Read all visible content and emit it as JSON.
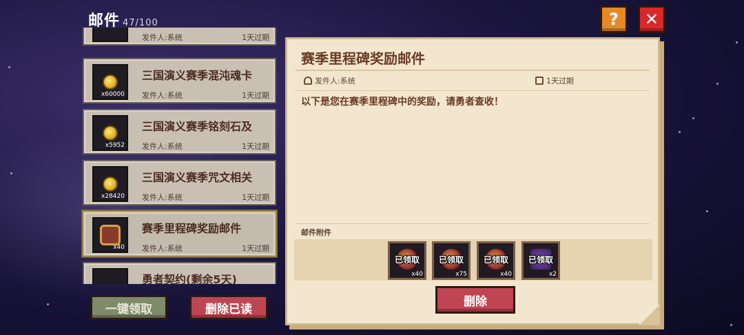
{
  "header": {
    "title": "邮件",
    "count": "47/100",
    "help": "?",
    "close": "✕"
  },
  "mail_list": [
    {
      "title": "",
      "sender": "发件人:系统",
      "expire": "1天过期",
      "qty": "",
      "icon": "item-icon"
    },
    {
      "title": "三国演义赛季混沌魂卡",
      "sender": "发件人:系统",
      "expire": "1天过期",
      "qty": "x60000",
      "icon": "gold-coin-icon"
    },
    {
      "title": "三国演义赛季铭刻石及",
      "sender": "发件人:系统",
      "expire": "1天过期",
      "qty": "x5952",
      "icon": "gold-coin-icon"
    },
    {
      "title": "三国演义赛季咒文相关",
      "sender": "发件人:系统",
      "expire": "1天过期",
      "qty": "x28420",
      "icon": "gold-coin-icon"
    },
    {
      "title": "赛季里程碑奖励邮件",
      "sender": "发件人:系统",
      "expire": "1天过期",
      "qty": "x40",
      "icon": "medal-icon"
    },
    {
      "title": "勇者契约(剩余5天)",
      "sender": "",
      "expire": "",
      "qty": "",
      "icon": "contract-icon"
    }
  ],
  "buttons": {
    "claim_all": "一键领取",
    "delete_read": "删除已读",
    "delete": "删除"
  },
  "detail": {
    "title": "赛季里程碑奖励邮件",
    "sender": "发件人:系统",
    "expire": "1天过期",
    "body": "以下是您在赛季里程碑中的奖励，请勇者查收！",
    "attachments_label": "邮件附件",
    "attachments": [
      {
        "status": "已领取",
        "qty": "x40"
      },
      {
        "status": "已领取",
        "qty": "x75"
      },
      {
        "status": "已领取",
        "qty": "x40"
      },
      {
        "status": "已领取",
        "qty": "x2"
      }
    ]
  },
  "colors": {
    "accent_red": "#c04553",
    "accent_orange": "#e58a25",
    "paper": "#f2e6cf"
  }
}
